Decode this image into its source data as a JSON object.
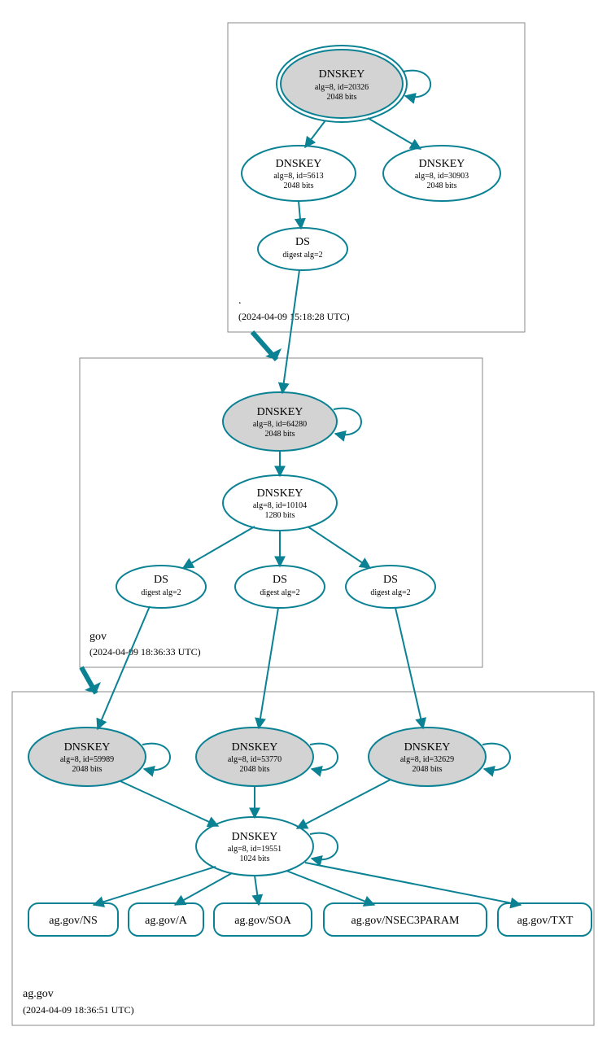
{
  "zones": {
    "root": {
      "label": ".",
      "timestamp": "(2024-04-09 15:18:28 UTC)"
    },
    "gov": {
      "label": "gov",
      "timestamp": "(2024-04-09 18:36:33 UTC)"
    },
    "aggov": {
      "label": "ag.gov",
      "timestamp": "(2024-04-09 18:36:51 UTC)"
    }
  },
  "nodes": {
    "root_ksk": {
      "title": "DNSKEY",
      "line2": "alg=8, id=20326",
      "line3": "2048 bits"
    },
    "root_zsk1": {
      "title": "DNSKEY",
      "line2": "alg=8, id=5613",
      "line3": "2048 bits"
    },
    "root_zsk2": {
      "title": "DNSKEY",
      "line2": "alg=8, id=30903",
      "line3": "2048 bits"
    },
    "root_ds": {
      "title": "DS",
      "line2": "digest alg=2"
    },
    "gov_ksk": {
      "title": "DNSKEY",
      "line2": "alg=8, id=64280",
      "line3": "2048 bits"
    },
    "gov_zsk": {
      "title": "DNSKEY",
      "line2": "alg=8, id=10104",
      "line3": "1280 bits"
    },
    "gov_ds1": {
      "title": "DS",
      "line2": "digest alg=2"
    },
    "gov_ds2": {
      "title": "DS",
      "line2": "digest alg=2"
    },
    "gov_ds3": {
      "title": "DS",
      "line2": "digest alg=2"
    },
    "ag_ksk1": {
      "title": "DNSKEY",
      "line2": "alg=8, id=59989",
      "line3": "2048 bits"
    },
    "ag_ksk2": {
      "title": "DNSKEY",
      "line2": "alg=8, id=53770",
      "line3": "2048 bits"
    },
    "ag_ksk3": {
      "title": "DNSKEY",
      "line2": "alg=8, id=32629",
      "line3": "2048 bits"
    },
    "ag_zsk": {
      "title": "DNSKEY",
      "line2": "alg=8, id=19551",
      "line3": "1024 bits"
    }
  },
  "records": {
    "ns": "ag.gov/NS",
    "a": "ag.gov/A",
    "soa": "ag.gov/SOA",
    "nsec3": "ag.gov/NSEC3PARAM",
    "txt": "ag.gov/TXT"
  }
}
